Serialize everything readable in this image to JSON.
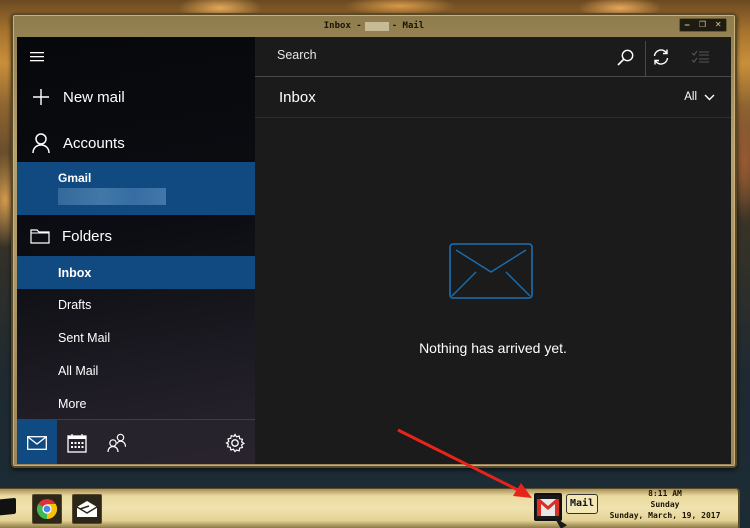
{
  "window": {
    "title_prefix": "Inbox -",
    "title_suffix": "- Mail",
    "controls": {
      "minimize": "‒",
      "restore": "❐",
      "close": "✕"
    }
  },
  "nav": {
    "menu_icon": "hamburger-icon",
    "new_mail": "New mail",
    "accounts": "Accounts",
    "account": {
      "name": "Gmail"
    },
    "folders_label": "Folders",
    "folders": [
      {
        "label": "Inbox",
        "selected": true
      },
      {
        "label": "Drafts",
        "selected": false
      },
      {
        "label": "Sent Mail",
        "selected": false
      },
      {
        "label": "All Mail",
        "selected": false
      },
      {
        "label": "More",
        "selected": false
      }
    ],
    "bottom_icons": [
      "mail-icon",
      "calendar-icon",
      "people-icon",
      "settings-icon"
    ]
  },
  "list": {
    "search_placeholder": "Search",
    "header_title": "Inbox",
    "filter_label": "All",
    "empty_message": "Nothing has arrived yet."
  },
  "taskbar": {
    "pinned": [
      "desktop-icon",
      "chrome-icon",
      "mail-app-icon",
      "gmail-icon"
    ],
    "tooltip": "Mail",
    "clock": {
      "time": "8:11 AM",
      "day": "Sunday",
      "date": "Sunday, March, 19, 2017"
    }
  },
  "colors": {
    "accent": "#114a80",
    "envelope_stroke": "#1a6fb3",
    "annotation_arrow": "#e8231c"
  }
}
